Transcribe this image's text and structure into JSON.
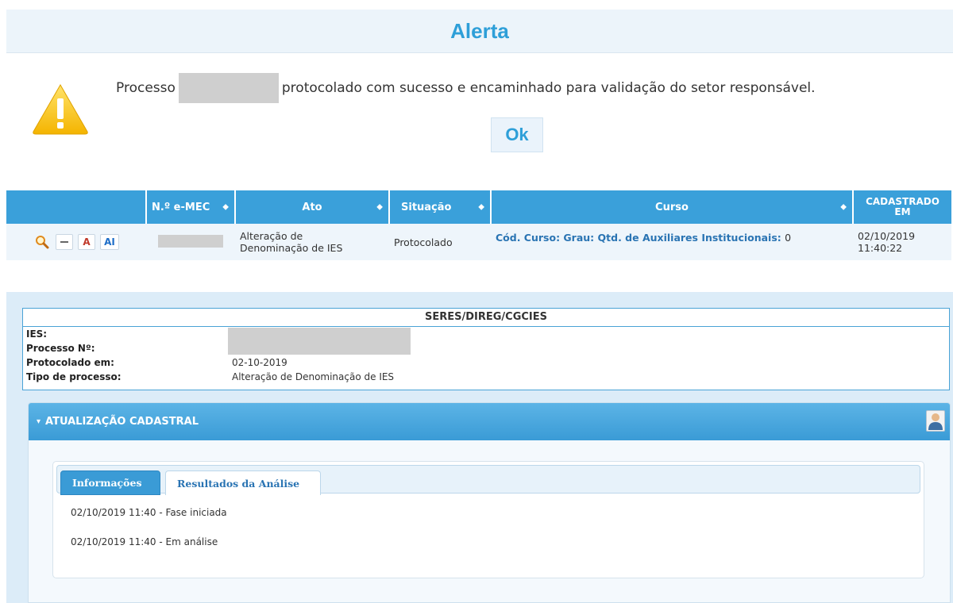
{
  "alert": {
    "title": "Alerta",
    "message_prefix": "Processo",
    "message_suffix": "protocolado com sucesso e encaminhado para validação do setor responsável.",
    "ok_label": "Ok"
  },
  "table": {
    "headers": [
      "N.º e-MEC",
      "Ato",
      "Situação",
      "Curso",
      "CADASTRADO EM"
    ],
    "header_last_line1": "CADASTRADO",
    "header_last_line2": "EM",
    "row": {
      "action_a": "A",
      "action_ai": "AI",
      "ato_line1": "Alteração de",
      "ato_line2": "Denominação de IES",
      "situacao": "Protocolado",
      "curso_label": "Cód. Curso: Grau: Qtd. de Auxiliares Institucionais:",
      "curso_value": "0",
      "data": "02/10/2019",
      "hora": "11:40:22"
    }
  },
  "seres": {
    "title": "SERES/DIREG/CGCIES",
    "labels": [
      "IES:",
      "Processo Nº:",
      "Protocolado em:",
      "Tipo de processo:"
    ],
    "protocolado_em": "02-10-2019",
    "tipo_processo": "Alteração de Denominação de IES"
  },
  "atualizacao": {
    "title": "ATUALIZAÇÃO CADASTRAL",
    "tabs": [
      "Informações",
      "Resultados da Análise"
    ],
    "log": [
      "02/10/2019 11:40 - Fase iniciada",
      "02/10/2019 11:40 - Em análise"
    ]
  }
}
